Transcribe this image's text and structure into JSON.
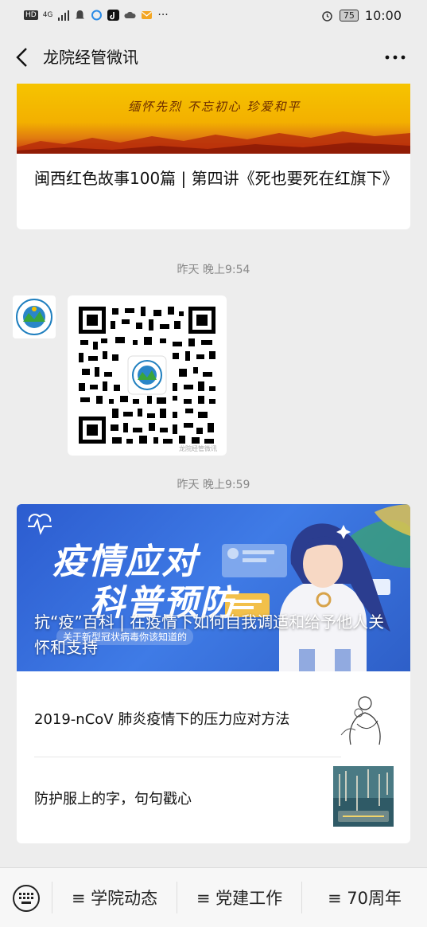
{
  "status_bar": {
    "hd": "HD",
    "network": "4G",
    "battery": "75",
    "time": "10:00"
  },
  "nav": {
    "title": "龙院经管微讯"
  },
  "article1": {
    "slogan": "缅怀先烈 不忘初心 珍爱和平",
    "title": "闽西红色故事100篇 | 第四讲《死也要死在红旗下》"
  },
  "timestamp1": "昨天 晚上9:54",
  "qr_message": {
    "watermark": "龙院经管微讯"
  },
  "timestamp2": "昨天 晚上9:59",
  "article2": {
    "cover_big_text_1": "疫情应对",
    "cover_big_text_2": "科普预防",
    "cover_small_text": "关于新型冠状病毒你该知道的",
    "cover_title": "抗“疫”百科 | 在疫情下如何自我调适和给予他人关怀和支持",
    "sub_articles": [
      {
        "title": "2019-nCoV 肺炎疫情下的压力应对方法"
      },
      {
        "title": "防护服上的字，句句戳心"
      }
    ]
  },
  "bottom_menu": {
    "items": [
      {
        "label": "≡ 学院动态"
      },
      {
        "label": "≡ 党建工作"
      },
      {
        "label": "≡ 70周年"
      }
    ]
  }
}
